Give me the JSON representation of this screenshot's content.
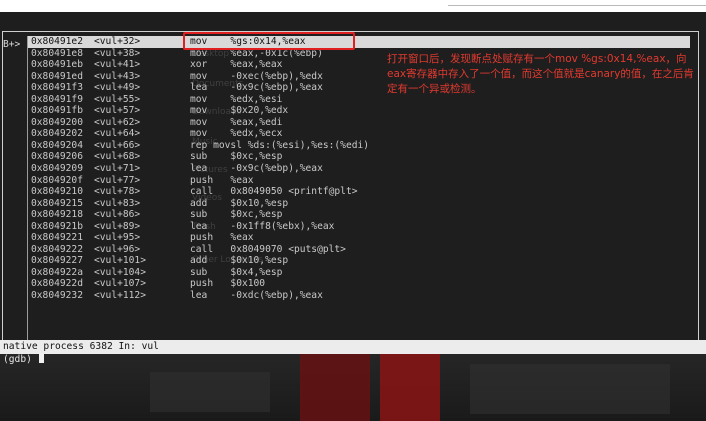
{
  "source_marker": "B+>",
  "asm_lines": [
    {
      "addr": "0x80491e2",
      "func": "<vul+32>",
      "ins": "mov    %gs:0x14,%eax",
      "current": true
    },
    {
      "addr": "0x80491e8",
      "func": "<vul+38>",
      "ins": "mov    %eax,-0x1c(%ebp)"
    },
    {
      "addr": "0x80491eb",
      "func": "<vul+41>",
      "ins": "xor    %eax,%eax"
    },
    {
      "addr": "0x80491ed",
      "func": "<vul+43>",
      "ins": "mov    -0xec(%ebp),%edx"
    },
    {
      "addr": "0x80491f3",
      "func": "<vul+49>",
      "ins": "lea    -0x9c(%ebp),%eax"
    },
    {
      "addr": "0x80491f9",
      "func": "<vul+55>",
      "ins": "mov    %edx,%esi"
    },
    {
      "addr": "0x80491fb",
      "func": "<vul+57>",
      "ins": "mov    $0x20,%edx"
    },
    {
      "addr": "0x8049200",
      "func": "<vul+62>",
      "ins": "mov    %eax,%edi"
    },
    {
      "addr": "0x8049202",
      "func": "<vul+64>",
      "ins": "mov    %edx,%ecx"
    },
    {
      "addr": "0x8049204",
      "func": "<vul+66>",
      "ins": "rep movsl %ds:(%esi),%es:(%edi)"
    },
    {
      "addr": "0x8049206",
      "func": "<vul+68>",
      "ins": "sub    $0xc,%esp"
    },
    {
      "addr": "0x8049209",
      "func": "<vul+71>",
      "ins": "lea    -0x9c(%ebp),%eax"
    },
    {
      "addr": "0x804920f",
      "func": "<vul+77>",
      "ins": "push   %eax"
    },
    {
      "addr": "0x8049210",
      "func": "<vul+78>",
      "ins": "call   0x8049050 <printf@plt>"
    },
    {
      "addr": "0x8049215",
      "func": "<vul+83>",
      "ins": "add    $0x10,%esp"
    },
    {
      "addr": "0x8049218",
      "func": "<vul+86>",
      "ins": "sub    $0xc,%esp"
    },
    {
      "addr": "0x804921b",
      "func": "<vul+89>",
      "ins": "lea    -0x1ff8(%ebx),%eax"
    },
    {
      "addr": "0x8049221",
      "func": "<vul+95>",
      "ins": "push   %eax"
    },
    {
      "addr": "0x8049222",
      "func": "<vul+96>",
      "ins": "call   0x8049070 <puts@plt>"
    },
    {
      "addr": "0x8049227",
      "func": "<vul+101>",
      "ins": "add    $0x10,%esp"
    },
    {
      "addr": "0x804922a",
      "func": "<vul+104>",
      "ins": "sub    $0x4,%esp"
    },
    {
      "addr": "0x804922d",
      "func": "<vul+107>",
      "ins": "push   $0x100"
    },
    {
      "addr": "0x8049232",
      "func": "<vul+112>",
      "ins": "lea    -0xdc(%ebp),%eax"
    }
  ],
  "annotation": "打开窗口后，发现断点处赋存有一个mov  %gs:0x14,%eax，向eax寄存器中存入了一个值，而这个值就是canary的值，在之后肯定有一个异或检测。",
  "status_line": "native process 6382 In: vul",
  "prompt": "(gdb) ",
  "ghost_labels": [
    "Desktop",
    "Documents",
    "Downloads",
    "Music",
    "Pictures",
    "Videos",
    "Trash",
    "Other Locations"
  ],
  "colors": {
    "terminal_bg": "#1e1e1e",
    "highlight_bg": "#d9d9d9",
    "annotation_red": "#e23a2f",
    "box_red": "#e02020"
  }
}
